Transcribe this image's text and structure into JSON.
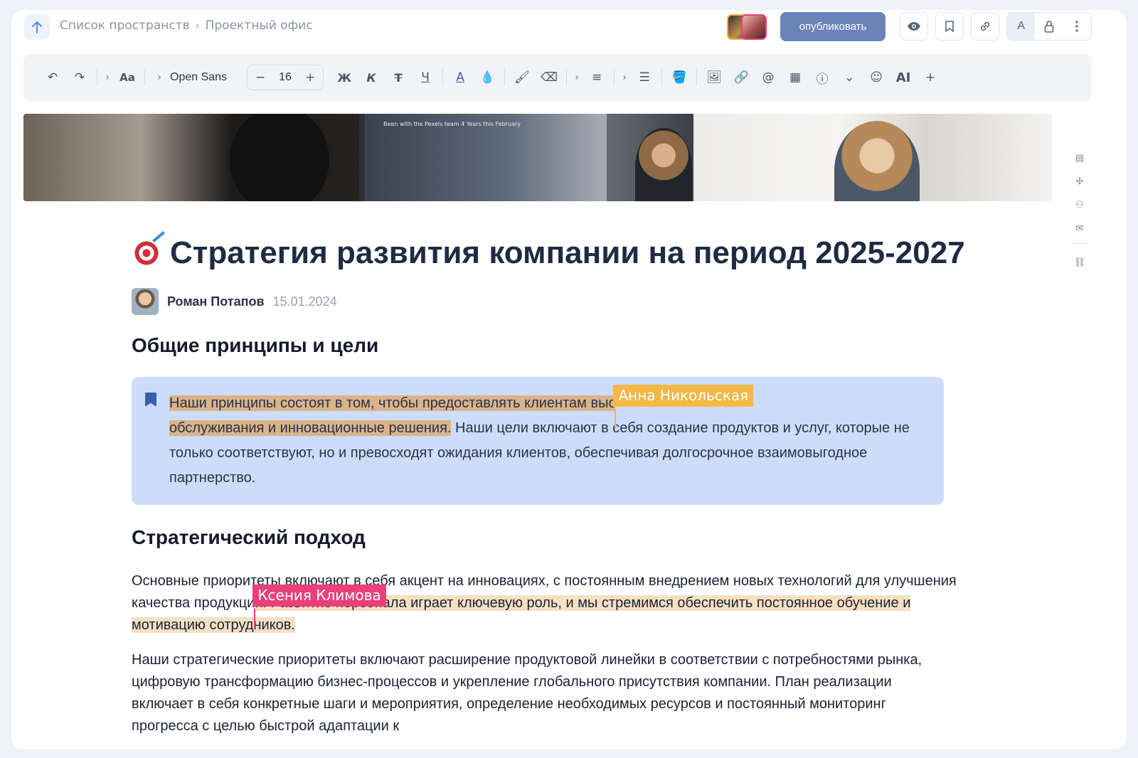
{
  "header": {
    "breadcrumbs": [
      "Список пространств",
      "Проектный офис"
    ],
    "publish_label": "опубликовать",
    "icons": [
      "arrow-up-icon",
      "eye-icon",
      "bookmark-icon",
      "link-icon",
      "text-mode-icon",
      "lock-icon",
      "more-vertical-icon"
    ],
    "text_mode_label": "A"
  },
  "toolbar": {
    "font_family": "Open Sans",
    "font_size": "16",
    "bold": "Ж",
    "italic": "К",
    "strike": "Т",
    "underline": "Ч",
    "ai": "AI",
    "text_style": "Aa"
  },
  "document": {
    "title": "Стратегия развития компании на период 2025-2027",
    "author": "Роман Потапов",
    "date": "15.01.2024",
    "section1_heading": "Общие принципы и цели",
    "callout": {
      "part1": "Наши принципы состоят в том, чтобы предоставлять клиентам выс",
      "part2": "обслуживания и инновационные решения.",
      "part3": " Наши цели включают в",
      "part4": " себя создание продуктов и услуг, которые не только соответствуют, но и превосходят ожидания клиентов, обеспечивая долгосрочное взаимовыгодное партнерство."
    },
    "section2_heading": "Стратегический подход",
    "para1": {
      "part1": "Основные приоритеты включают в себя акцент на инновациях, с постоянным внедрением новых технологий для улучшения качества продукци",
      "part2": "и. Развитие персонала играет ключевую роль, и мы стремимся обеспечить постоянное обучение и",
      "part3": " мотивацию сотрудников."
    },
    "para2": "Наши стратегические приоритеты включают расширение продуктовой линейки в соответствии с потребностями рынка, цифровую трансформацию бизнес-процессов и укрепление глобального присутствия компании. План реализации включает в себя конкретные шаги и мероприятия, определение необходимых ресурсов и постоянный мониторинг прогресса с целью быстрой адаптации к"
  },
  "collaborators": {
    "anna": "Анна Никольская",
    "ksenia": "Ксения Климова"
  },
  "cover_text": "Been with the Pexels team 4 Years this February",
  "colors": {
    "publish": "#6a84b8",
    "callout_bg": "#cdddf9",
    "anna": "#f4b845",
    "ksenia": "#e94079"
  }
}
